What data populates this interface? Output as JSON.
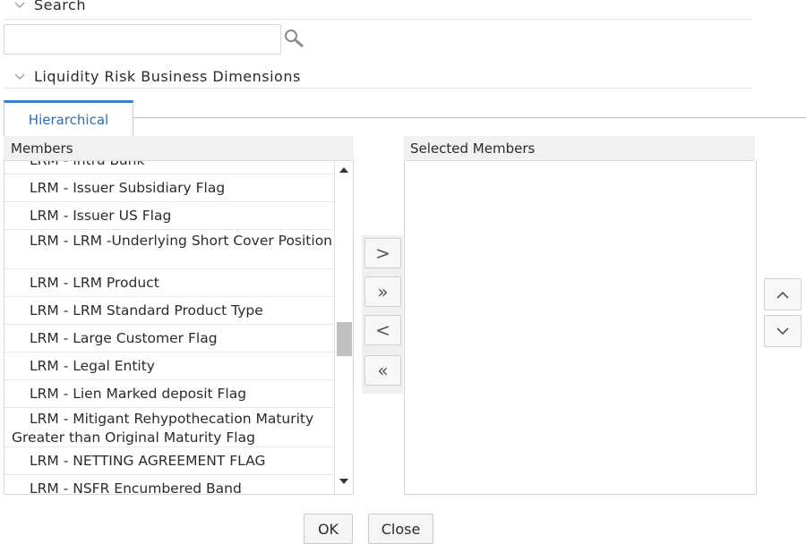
{
  "sections": {
    "search": {
      "label": "Search",
      "icon": "chevron-down-icon"
    },
    "dimensions": {
      "label": "Liquidity Risk Business Dimensions",
      "icon": "chevron-down-icon"
    }
  },
  "search": {
    "value": "",
    "placeholder": ""
  },
  "tabs": [
    {
      "label": "Hierarchical",
      "active": true
    }
  ],
  "members": {
    "header": "Members",
    "items": [
      "LRM - Intra Bank",
      "LRM - Issuer Subsidiary Flag",
      "LRM - Issuer US Flag",
      "LRM - LRM -Underlying Short Cover Position",
      "LRM - LRM Product",
      "LRM - LRM Standard Product Type",
      "LRM - Large Customer Flag",
      "LRM - Legal Entity",
      "LRM - Lien Marked deposit Flag",
      "LRM - Mitigant Rehypothecation Maturity Greater than Original Maturity Flag",
      "LRM - NETTING AGREEMENT FLAG",
      "LRM - NSFR Encumbered Band"
    ]
  },
  "selected": {
    "header": "Selected Members",
    "items": []
  },
  "shuttle": {
    "move": ">",
    "move_all": "»",
    "remove": "<",
    "remove_all": "«"
  },
  "footer": {
    "ok": "OK",
    "close": "Close"
  },
  "colors": {
    "accent": "#3b7fc4",
    "tab_text": "#2b6fb3",
    "header_bg": "#f1f1f1"
  }
}
